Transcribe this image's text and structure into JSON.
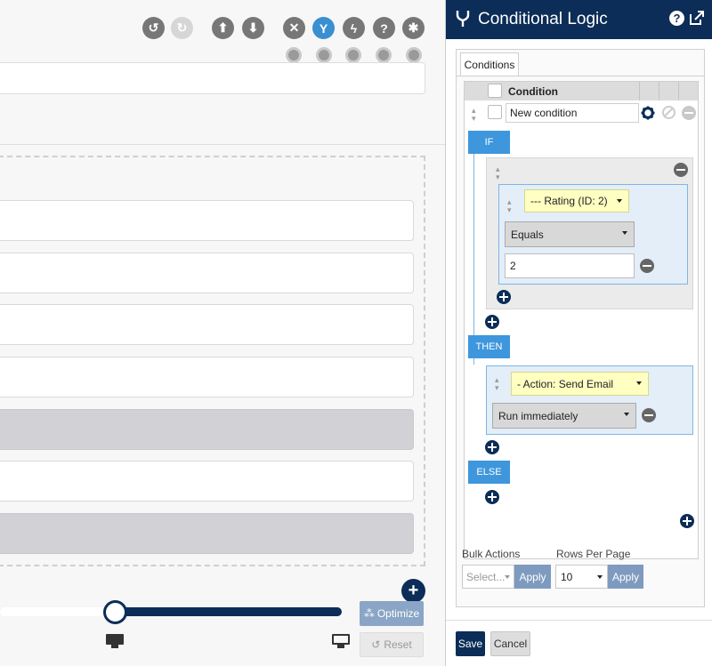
{
  "app": {
    "accent": "#0b2d57",
    "keyword_color": "#3e96dc"
  },
  "toolbar": {
    "icons": [
      "history-icon",
      "redo-icon",
      "upload-icon",
      "download-icon",
      "tools-icon",
      "conditional-logic-icon",
      "lightning-icon",
      "help-icon",
      "settings-icon"
    ]
  },
  "canvas": {
    "optimize_label": "Optimize",
    "reset_label": "Reset",
    "zoom_level": 0.0
  },
  "panel": {
    "title": "Conditional Logic",
    "tabs": [
      {
        "label": "Conditions"
      }
    ],
    "table": {
      "header": "Condition",
      "rows": [
        {
          "name": "New condition"
        }
      ]
    },
    "if_label": "IF",
    "then_label": "THEN",
    "else_label": "ELSE",
    "rule": {
      "field": "--- Rating (ID: 2)",
      "operator": "Equals",
      "value": "2"
    },
    "action": {
      "name": "- Action: Send Email",
      "timing": "Run immediately"
    },
    "bulk_actions": {
      "label": "Bulk Actions",
      "placeholder": "Select...",
      "apply": "Apply"
    },
    "rows_per_page": {
      "label": "Rows Per Page",
      "value": "10",
      "apply": "Apply"
    },
    "save_label": "Save",
    "cancel_label": "Cancel"
  }
}
